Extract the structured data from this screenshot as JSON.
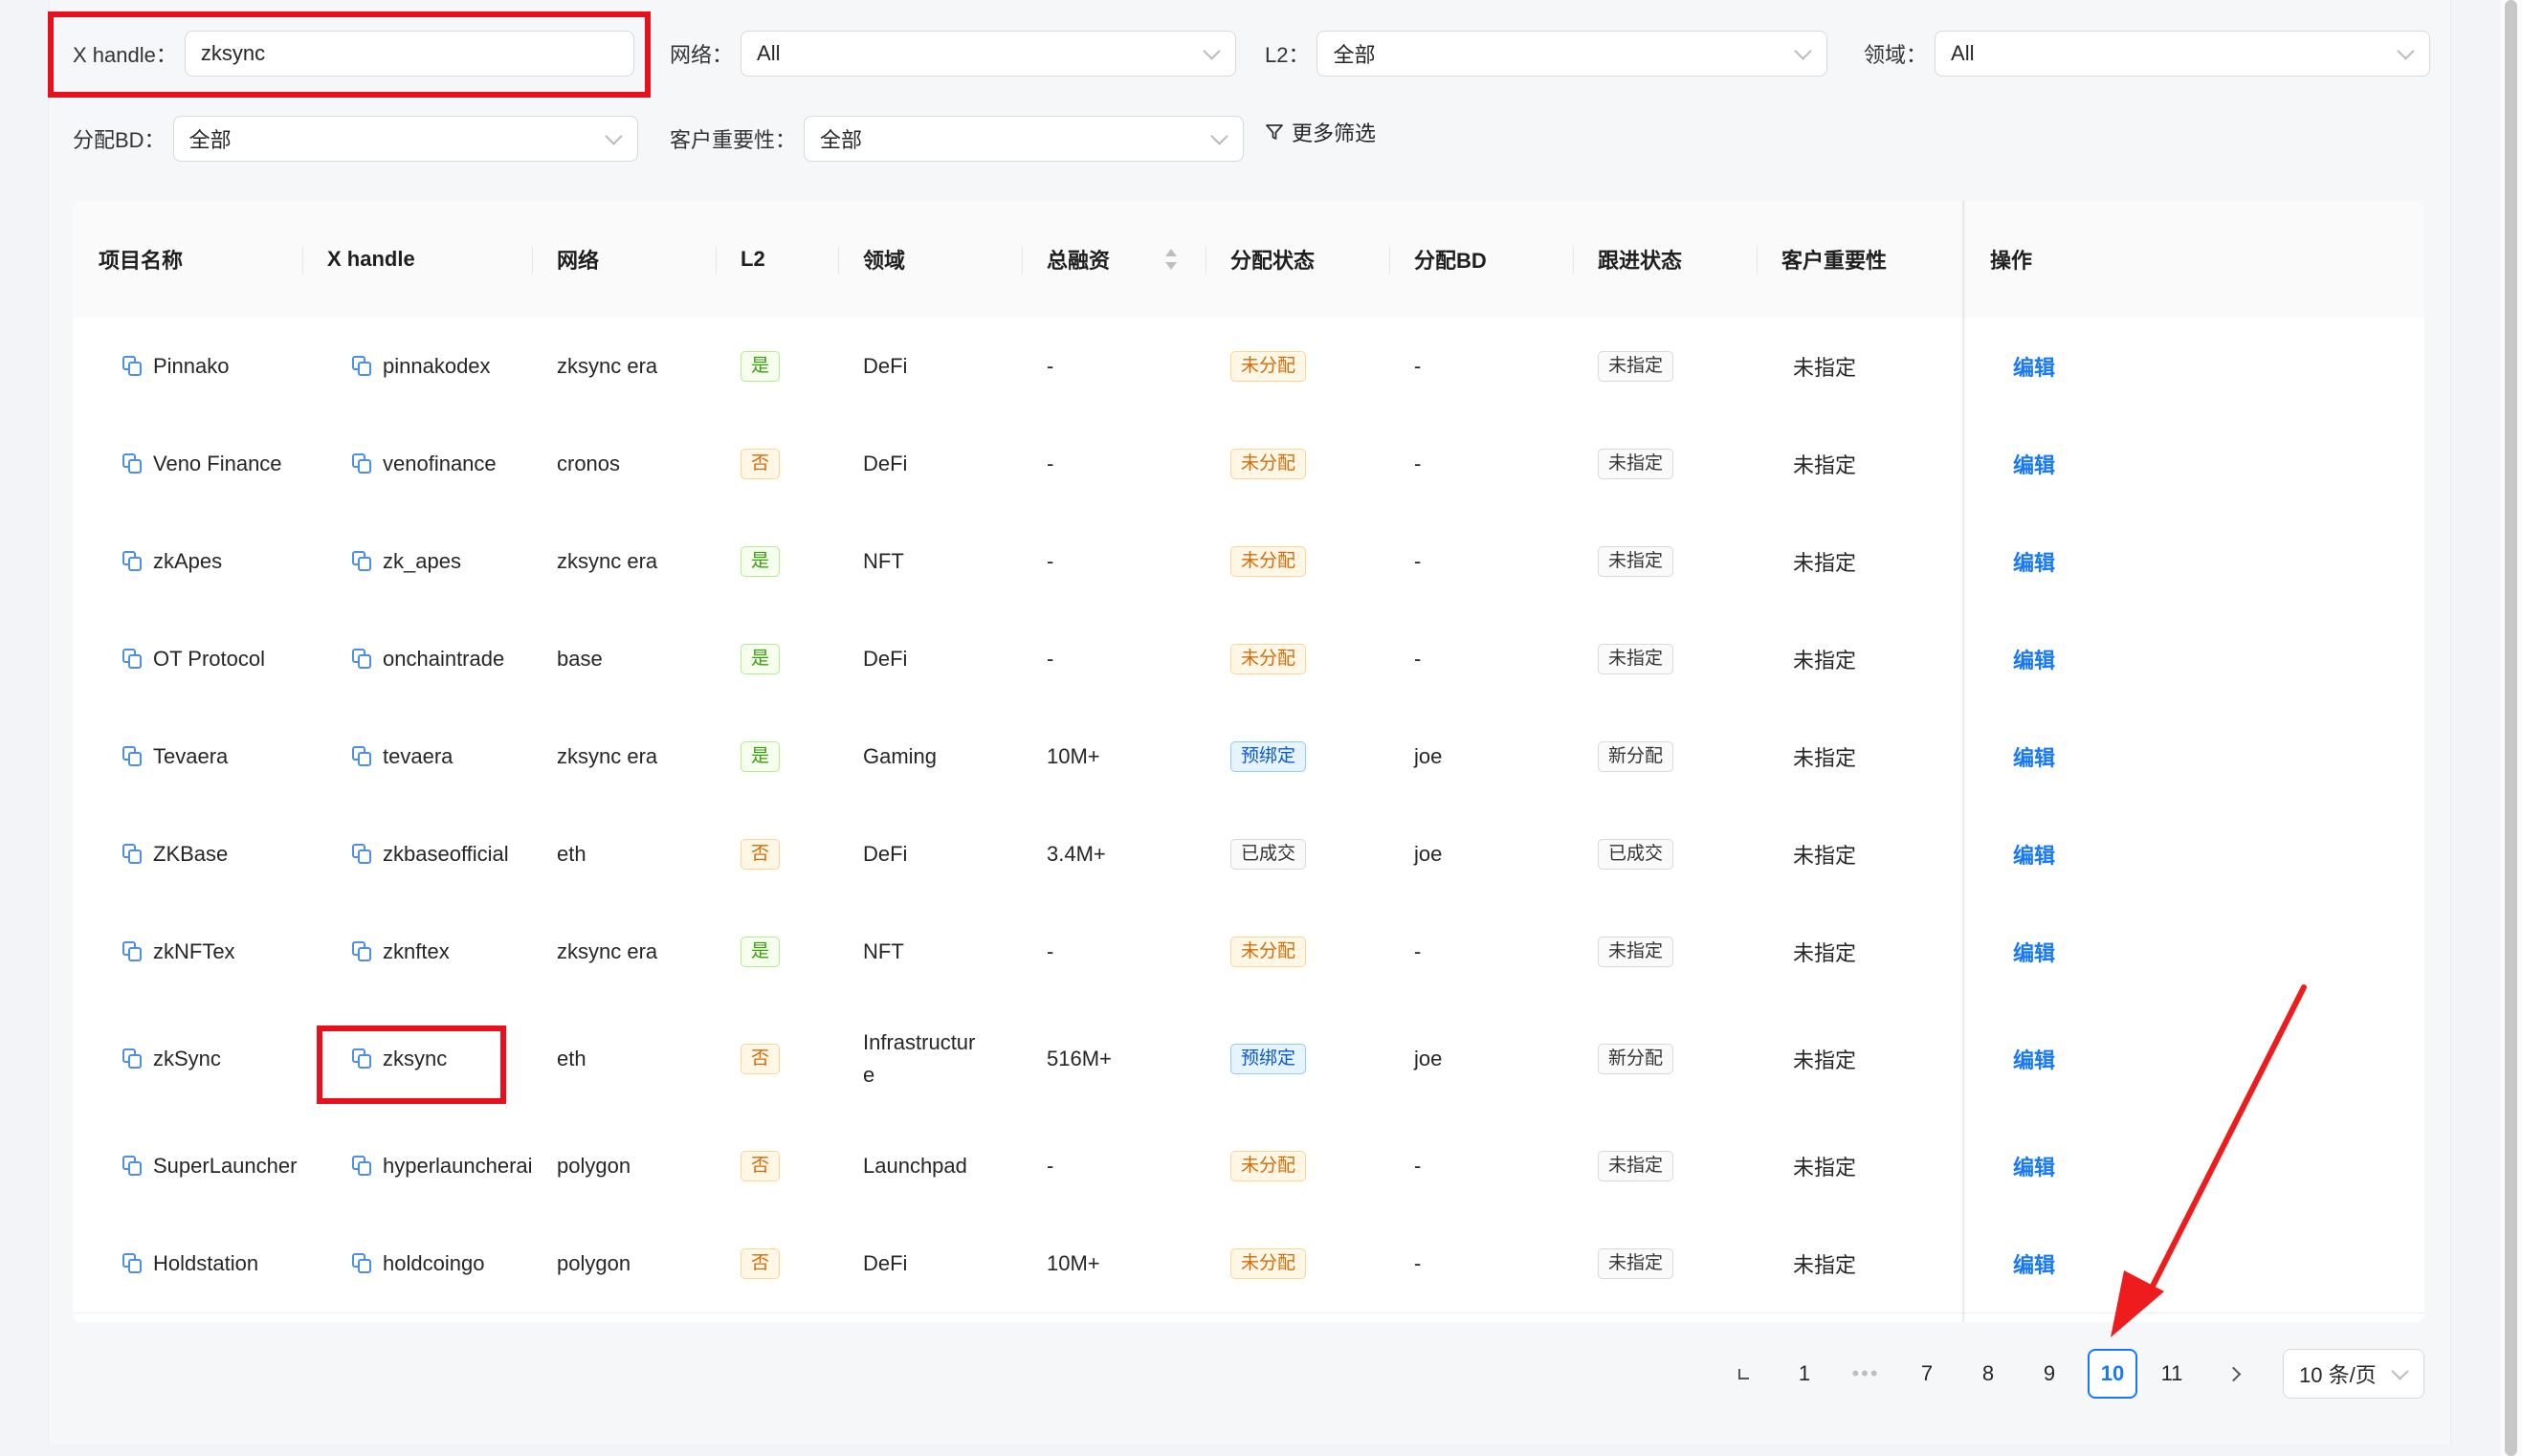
{
  "filters": {
    "x_handle": {
      "label": "X handle：",
      "value": "zksync"
    },
    "network": {
      "label": "网络：",
      "value": "All"
    },
    "l2": {
      "label": "L2：",
      "value": "全部"
    },
    "domain": {
      "label": "领域：",
      "value": "All"
    },
    "bd": {
      "label": "分配BD：",
      "value": "全部"
    },
    "importance": {
      "label": "客户重要性：",
      "value": "全部"
    },
    "more_label": "更多筛选"
  },
  "table": {
    "columns": [
      "项目名称",
      "X handle",
      "网络",
      "L2",
      "领域",
      "总融资",
      "分配状态",
      "分配BD",
      "跟进状态",
      "客户重要性",
      "操作"
    ],
    "rows": [
      {
        "name": "Pinnako",
        "handle": "pinnakodex",
        "network": "zksync era",
        "l2": "是",
        "domain": "DeFi",
        "domain2": "",
        "funding": "-",
        "assign": "未分配",
        "bd": "-",
        "follow": "未指定",
        "importance": "未指定",
        "action": "编辑"
      },
      {
        "name": "Veno Finance",
        "handle": "venofinance",
        "network": "cronos",
        "l2": "否",
        "domain": "DeFi",
        "domain2": "",
        "funding": "-",
        "assign": "未分配",
        "bd": "-",
        "follow": "未指定",
        "importance": "未指定",
        "action": "编辑"
      },
      {
        "name": "zkApes",
        "handle": "zk_apes",
        "network": "zksync era",
        "l2": "是",
        "domain": "NFT",
        "domain2": "",
        "funding": "-",
        "assign": "未分配",
        "bd": "-",
        "follow": "未指定",
        "importance": "未指定",
        "action": "编辑"
      },
      {
        "name": "OT Protocol",
        "handle": "onchaintrade",
        "network": "base",
        "l2": "是",
        "domain": "DeFi",
        "domain2": "",
        "funding": "-",
        "assign": "未分配",
        "bd": "-",
        "follow": "未指定",
        "importance": "未指定",
        "action": "编辑"
      },
      {
        "name": "Tevaera",
        "handle": "tevaera",
        "network": "zksync era",
        "l2": "是",
        "domain": "Gaming",
        "domain2": "",
        "funding": "10M+",
        "assign": "预绑定",
        "bd": "joe",
        "follow": "新分配",
        "importance": "未指定",
        "action": "编辑"
      },
      {
        "name": "ZKBase",
        "handle": "zkbaseofficial",
        "network": "eth",
        "l2": "否",
        "domain": "DeFi",
        "domain2": "",
        "funding": "3.4M+",
        "assign": "已成交",
        "bd": "joe",
        "follow": "已成交",
        "importance": "未指定",
        "action": "编辑"
      },
      {
        "name": "zkNFTex",
        "handle": "zknftex",
        "network": "zksync era",
        "l2": "是",
        "domain": "NFT",
        "domain2": "",
        "funding": "-",
        "assign": "未分配",
        "bd": "-",
        "follow": "未指定",
        "importance": "未指定",
        "action": "编辑"
      },
      {
        "name": "zkSync",
        "handle": "zksync",
        "network": "eth",
        "l2": "否",
        "domain": "Infrastructur",
        "domain2": "e",
        "funding": "516M+",
        "assign": "预绑定",
        "bd": "joe",
        "follow": "新分配",
        "importance": "未指定",
        "action": "编辑"
      },
      {
        "name": "SuperLauncher",
        "handle": "hyperlauncherai",
        "network": "polygon",
        "l2": "否",
        "domain": "Launchpad",
        "domain2": "",
        "funding": "-",
        "assign": "未分配",
        "bd": "-",
        "follow": "未指定",
        "importance": "未指定",
        "action": "编辑"
      },
      {
        "name": "Holdstation",
        "handle": "holdcoingo",
        "network": "polygon",
        "l2": "否",
        "domain": "DeFi",
        "domain2": "",
        "funding": "10M+",
        "assign": "未分配",
        "bd": "-",
        "follow": "未指定",
        "importance": "未指定",
        "action": "编辑"
      }
    ]
  },
  "pagination": {
    "pages": [
      "1",
      "•••",
      "7",
      "8",
      "9",
      "10",
      "11"
    ],
    "current": "10",
    "page_size": "10 条/页"
  },
  "colors": {
    "accent": "#1677ff",
    "highlight": "#e8101c"
  }
}
